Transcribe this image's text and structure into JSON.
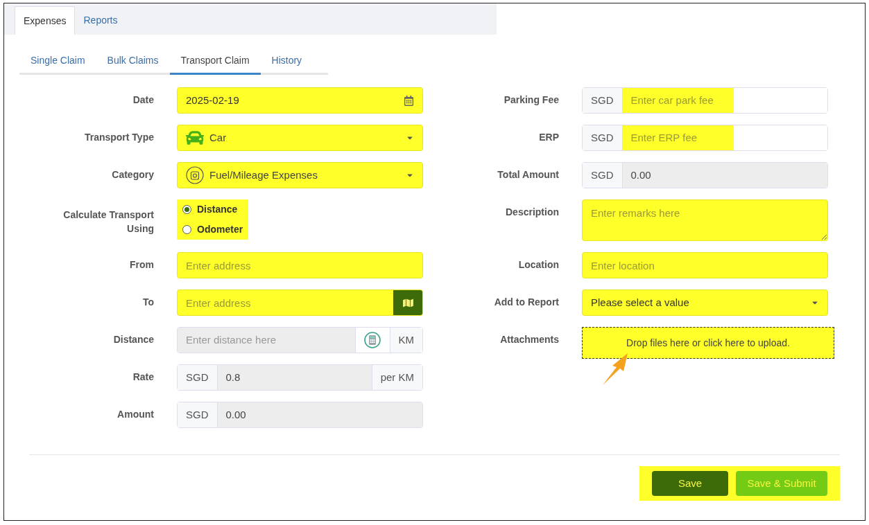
{
  "main_tabs": [
    {
      "label": "Expenses",
      "selected": true
    },
    {
      "label": "Reports",
      "selected": false
    }
  ],
  "sub_tabs": [
    {
      "label": "Single Claim",
      "selected": false
    },
    {
      "label": "Bulk Claims",
      "selected": false
    },
    {
      "label": "Transport Claim",
      "selected": true
    },
    {
      "label": "History",
      "selected": false
    }
  ],
  "left_fields": [
    {
      "kind": "date",
      "label": "Date",
      "value": "2025-02-19",
      "highlighted": true
    },
    {
      "kind": "vehicle",
      "label": "Transport Type",
      "value": "Car",
      "highlighted": true
    },
    {
      "kind": "category",
      "label": "Category",
      "value": "Fuel/Mileage Expenses",
      "highlighted": true
    },
    {
      "kind": "radio",
      "label": "Calculate Transport Using",
      "highlighted": true,
      "options": [
        {
          "label": "Distance",
          "selected": true
        },
        {
          "label": "Odometer",
          "selected": false
        }
      ]
    },
    {
      "kind": "text",
      "label": "From",
      "placeholder": "Enter address",
      "highlighted": true
    },
    {
      "kind": "map",
      "label": "To",
      "placeholder": "Enter address",
      "highlighted": true
    },
    {
      "kind": "addon",
      "label": "Distance",
      "placeholder": "Enter distance here",
      "calculator": true,
      "suffix": "KM",
      "disabled": true,
      "highlighted": false
    },
    {
      "kind": "addon",
      "label": "Rate",
      "prefix": "SGD",
      "value": "0.8",
      "suffix": "per KM",
      "disabled": true,
      "highlighted": false
    },
    {
      "kind": "addon",
      "label": "Amount",
      "prefix": "SGD",
      "value": "0.00",
      "disabled": true,
      "highlighted": false
    }
  ],
  "right_fields": [
    {
      "kind": "addon",
      "label": "Parking Fee",
      "prefix": "SGD",
      "placeholder": "Enter car park fee",
      "disabled": false,
      "highlighted": true
    },
    {
      "kind": "addon",
      "label": "ERP",
      "prefix": "SGD",
      "placeholder": "Enter ERP fee",
      "disabled": false,
      "highlighted": true
    },
    {
      "kind": "addon",
      "label": "Total Amount",
      "prefix": "SGD",
      "value": "0.00",
      "disabled": true,
      "highlighted": false
    },
    {
      "kind": "textarea",
      "label": "Description",
      "placeholder": "Enter remarks here",
      "highlighted": true
    },
    {
      "kind": "text",
      "label": "Location",
      "placeholder": "Enter location",
      "highlighted": true
    },
    {
      "kind": "dropdown",
      "label": "Add to Report",
      "value": "Please select a value",
      "highlighted": true
    },
    {
      "kind": "upload",
      "label": "Attachments",
      "text": "Drop files here or click here to upload.",
      "highlighted": true,
      "pointer": true
    }
  ],
  "buttons": [
    {
      "label": "Save",
      "kind": "primary"
    },
    {
      "label": "Save & Submit",
      "kind": "secondary"
    }
  ],
  "buttons_highlighted": true
}
